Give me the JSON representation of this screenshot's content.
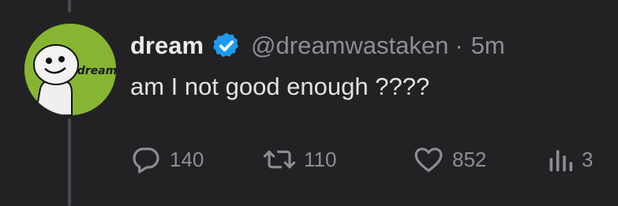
{
  "tweet": {
    "display_name": "dream",
    "verified_icon": "verified-badge-icon",
    "handle": "@dreamwastaken",
    "separator": "·",
    "time": "5m",
    "text": "am I not good enough ????",
    "avatar_label": "dream"
  },
  "actions": {
    "reply": {
      "icon": "reply-icon",
      "count": "140"
    },
    "retweet": {
      "icon": "retweet-icon",
      "count": "110"
    },
    "like": {
      "icon": "like-icon",
      "count": "852"
    },
    "views": {
      "icon": "views-icon",
      "count": "3"
    }
  },
  "colors": {
    "background": "#222224",
    "avatar_green": "#86b532",
    "verified_blue": "#1d9bf0",
    "muted_text": "#8b8f94"
  }
}
